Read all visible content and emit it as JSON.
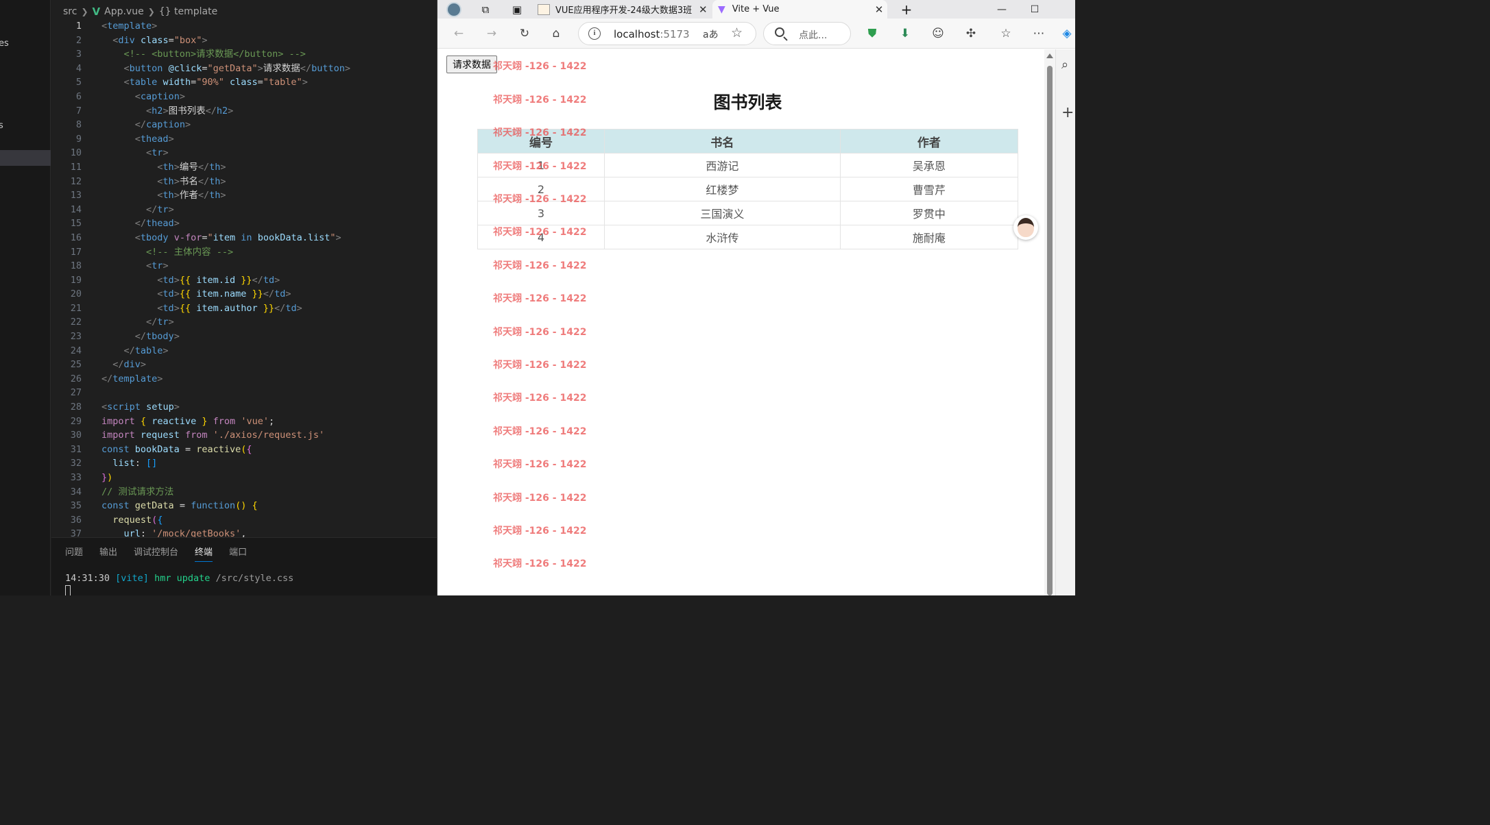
{
  "sidebar": {
    "frag_top": "es",
    "frag_mid": "s"
  },
  "breadcrumb": {
    "src": "src",
    "file": "App.vue",
    "symbol": "{} template"
  },
  "editor": {
    "active_line": 1,
    "line_numbers": [
      "1",
      "2",
      "3",
      "4",
      "5",
      "6",
      "7",
      "8",
      "9",
      "10",
      "11",
      "12",
      "13",
      "14",
      "15",
      "16",
      "17",
      "18",
      "19",
      "20",
      "21",
      "22",
      "23",
      "24",
      "25",
      "26",
      "27",
      "28",
      "29",
      "30",
      "31",
      "32",
      "33",
      "34",
      "35",
      "36",
      "37"
    ]
  },
  "code": {
    "l1_tag": "template",
    "l2_tag": "div",
    "l2_attr": "class",
    "l2_val": "\"box\"",
    "l3": "<!-- <button>请求数据</button> -->",
    "l4_tag": "button",
    "l4_attr": "@click",
    "l4_val": "\"getData\"",
    "l4_text": "请求数据",
    "l4_close": "button",
    "l5_tag": "table",
    "l5_attr1": "width",
    "l5_val1": "\"90%\"",
    "l5_attr2": "class",
    "l5_val2": "\"table\"",
    "l6_tag": "caption",
    "l7_tag": "h2",
    "l7_text": "图书列表",
    "l7_close": "h2",
    "l8_tag": "caption",
    "l9_tag": "thead",
    "l10_tag": "tr",
    "l11_tag": "th",
    "l11_text": "编号",
    "l12_tag": "th",
    "l12_text": "书名",
    "l13_tag": "th",
    "l13_text": "作者",
    "l14_tag": "tr",
    "l15_tag": "thead",
    "l16_tag": "tbody",
    "l16_attr": "v-for",
    "l16_q1": "\"",
    "l16_item": "item",
    "l16_in": "in",
    "l16_list": "bookData.list",
    "l16_q2": "\"",
    "l17": "<!-- 主体内容 -->",
    "l18_tag": "tr",
    "l19_tag": "td",
    "l19_expr": "item.id",
    "l20_tag": "td",
    "l20_expr": "item.name",
    "l21_tag": "td",
    "l21_expr": "item.author",
    "l22_tag": "tr",
    "l23_tag": "tbody",
    "l24_tag": "table",
    "l25_tag": "div",
    "l26_tag": "template",
    "l28_tag": "script",
    "l28_attr": "setup",
    "l29_import": "import",
    "l29_name": "reactive",
    "l29_from": "from",
    "l29_mod": "'vue'",
    "l30_import": "import",
    "l30_name": "request",
    "l30_from": "from",
    "l30_mod": "'./axios/request.js'",
    "l31_const": "const",
    "l31_name": "bookData",
    "l31_fn": "reactive",
    "l32_key": "list",
    "l34": "// 测试请求方法",
    "l35_const": "const",
    "l35_name": "getData",
    "l35_fn": "function",
    "l36_fn": "request",
    "l37_key": "url",
    "l37_val": "'/mock/getBooks'"
  },
  "panel": {
    "tabs": [
      "问题",
      "输出",
      "调试控制台",
      "终端",
      "端口"
    ],
    "active_tab": "终端",
    "term_time": "14:31:30",
    "term_vite": "[vite]",
    "term_hmr": "hmr update",
    "term_path": "/src/style.css"
  },
  "browser": {
    "tab1_title": "VUE应用程序开发-24级大数据3班",
    "tab2_title": "Vite + Vue",
    "url_host": "localhost",
    "url_port": ":5173",
    "search_placeholder": "点此...",
    "read_aloud": "aあ"
  },
  "page": {
    "button_label": "请求数据",
    "caption": "图书列表",
    "headers": [
      "编号",
      "书名",
      "作者"
    ],
    "rows": [
      {
        "id": "1",
        "name": "西游记",
        "author": "吴承恩"
      },
      {
        "id": "2",
        "name": "红楼梦",
        "author": "曹雪芹"
      },
      {
        "id": "3",
        "name": "三国演义",
        "author": "罗贯中"
      },
      {
        "id": "4",
        "name": "水浒传",
        "author": "施耐庵"
      }
    ],
    "watermark": "祁天翊 -126 - 1422"
  },
  "colors": {
    "vs_bg": "#1f1f1f",
    "table_header_bg": "#cfe8ec",
    "watermark": "#ea5050",
    "vue_green": "#41b883"
  }
}
